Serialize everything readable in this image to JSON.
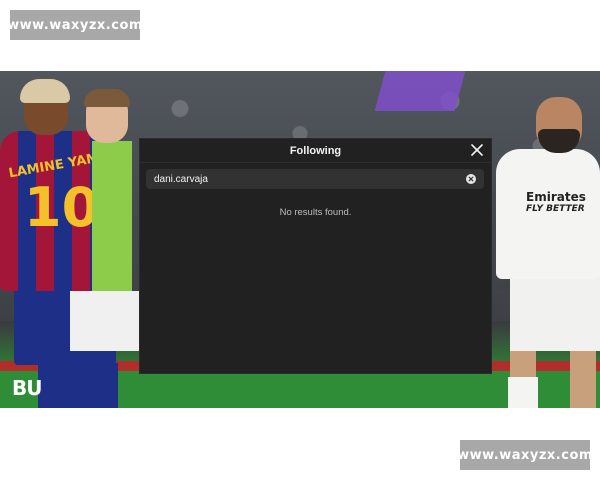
{
  "watermarks": {
    "top": "www.waxyzx.com",
    "bottom": "www.waxyzx.com"
  },
  "photo": {
    "left_player_name": "LAMINE YAMAL",
    "left_player_number": "10",
    "right_player_sponsor": "Emirates",
    "right_player_sponsor_sub": "FLY BETTER",
    "channel_logo": "BU"
  },
  "dialog": {
    "title": "Following",
    "search": {
      "value": "dani.carvaja",
      "placeholder": ""
    },
    "empty_message": "No results found."
  },
  "icons": {
    "close": "close-icon",
    "clear": "clear-circle-icon"
  },
  "colors": {
    "dialog_bg": "#212121",
    "search_bg": "#323232",
    "text": "#f2f2f2",
    "muted": "#bdbdbd"
  }
}
